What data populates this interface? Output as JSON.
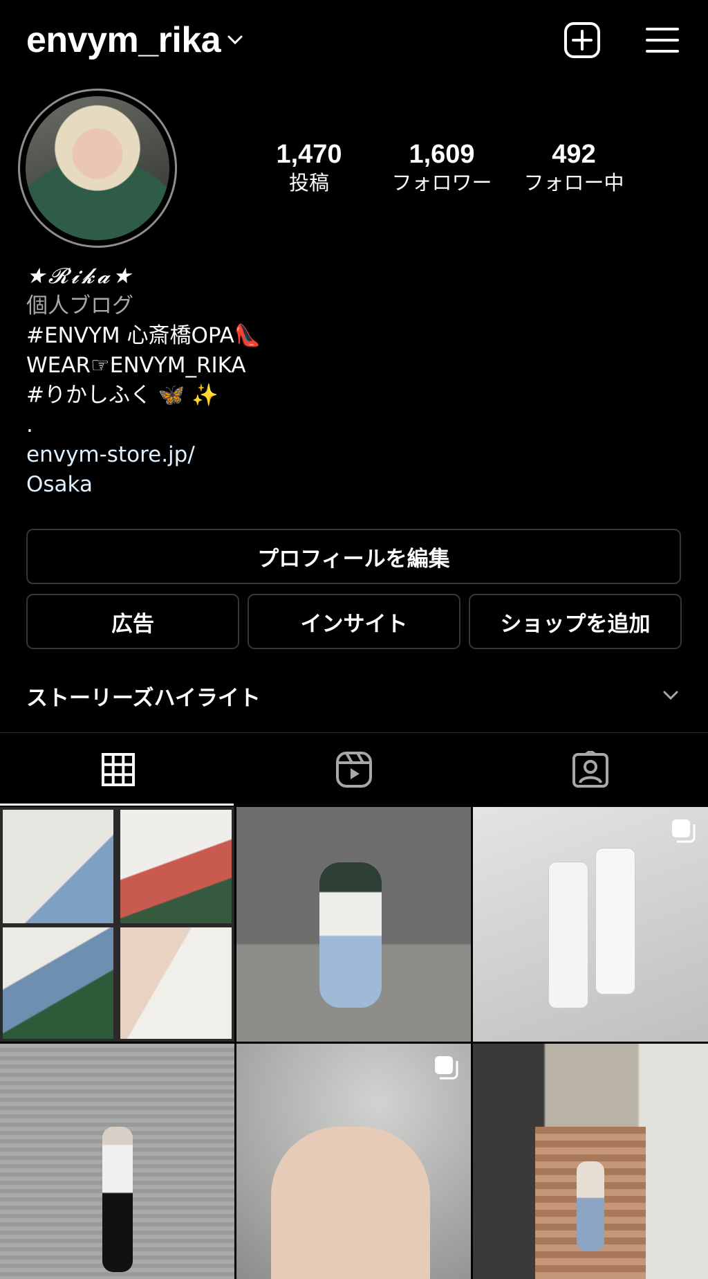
{
  "header": {
    "username": "envym_rika",
    "icons": [
      "chevron-down-icon",
      "new-post-icon",
      "menu-icon"
    ]
  },
  "profile": {
    "stats": [
      {
        "value": "1,470",
        "label": "投稿"
      },
      {
        "value": "1,609",
        "label": "フォロワー"
      },
      {
        "value": "492",
        "label": "フォロー中"
      }
    ],
    "bio": {
      "display_name": "★𝓡𝓲𝓴𝓪★",
      "category": "個人ブログ",
      "line1": "#ENVYM 心斎橋OPA👠",
      "line2": "WEAR☞ENVYM_RIKA",
      "line3": "#りかしふく 🦋 ✨",
      "line4": ".",
      "website": "envym-store.jp/",
      "location": "Osaka"
    }
  },
  "actions": {
    "edit_profile": "プロフィールを編集",
    "ads": "広告",
    "insights": "インサイト",
    "add_shop": "ショップを追加"
  },
  "highlights": {
    "label": "ストーリーズハイライト"
  },
  "tabs": [
    {
      "icon": "grid-icon",
      "active": true
    },
    {
      "icon": "reels-icon",
      "active": false
    },
    {
      "icon": "tagged-icon",
      "active": false
    }
  ],
  "colors": {
    "background": "#000000",
    "border": "#363636",
    "muted_text": "#a8a8a8",
    "link_text": "#e0f1ff"
  }
}
